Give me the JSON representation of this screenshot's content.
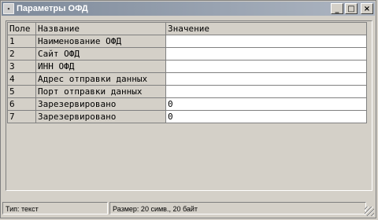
{
  "window": {
    "title": "Параметры ОФД",
    "buttons": {
      "minimize": "_",
      "maximize": "□",
      "close": "×"
    }
  },
  "table": {
    "columns": [
      "Поле",
      "Название",
      "Значение"
    ],
    "rows": [
      {
        "field": "1",
        "name": "Наименование ОФД",
        "value": ""
      },
      {
        "field": "2",
        "name": "Сайт ОФД",
        "value": ""
      },
      {
        "field": "3",
        "name": "ИНН ОФД",
        "value": ""
      },
      {
        "field": "4",
        "name": "Адрес отправки данных",
        "value": ""
      },
      {
        "field": "5",
        "name": "Порт отправки данных",
        "value": ""
      },
      {
        "field": "6",
        "name": "Зарезервировано",
        "value": "0"
      },
      {
        "field": "7",
        "name": "Зарезервировано",
        "value": "0"
      }
    ]
  },
  "statusbar": {
    "type": "Тип: текст",
    "size": "Размер: 20 симв., 20 байт"
  }
}
